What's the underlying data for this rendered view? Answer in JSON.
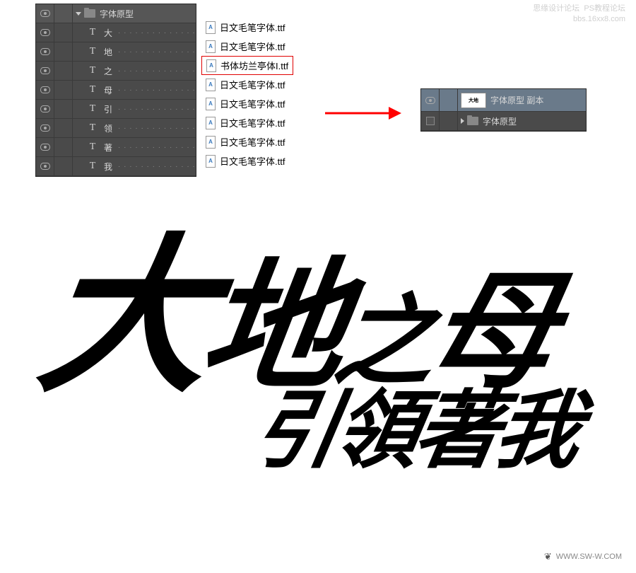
{
  "left_panel": {
    "group_name": "字体原型",
    "layers": [
      {
        "name": "大"
      },
      {
        "name": "地"
      },
      {
        "name": "之"
      },
      {
        "name": "母"
      },
      {
        "name": "引"
      },
      {
        "name": "领"
      },
      {
        "name": "著"
      },
      {
        "name": "我"
      }
    ]
  },
  "font_files": [
    {
      "name": "日文毛笔字体.ttf",
      "highlighted": false
    },
    {
      "name": "日文毛笔字体.ttf",
      "highlighted": false
    },
    {
      "name": "书体坊兰亭体I.ttf",
      "highlighted": true
    },
    {
      "name": "日文毛笔字体.ttf",
      "highlighted": false
    },
    {
      "name": "日文毛笔字体.ttf",
      "highlighted": false
    },
    {
      "name": "日文毛笔字体.ttf",
      "highlighted": false
    },
    {
      "name": "日文毛笔字体.ttf",
      "highlighted": false
    },
    {
      "name": "日文毛笔字体.ttf",
      "highlighted": false
    }
  ],
  "right_panel": {
    "layers": [
      {
        "name": "字体原型 副本",
        "type": "smart",
        "selected": true
      },
      {
        "name": "字体原型",
        "type": "folder",
        "selected": false
      }
    ]
  },
  "calligraphy": {
    "line1": "大地之母",
    "line2": "引領著我"
  },
  "watermark_top": {
    "l1": "思缘设计论坛",
    "l2": "PS教程论坛",
    "l3": "bbs.16xx8.com"
  },
  "watermark_bottom": "WWW.SW-W.COM",
  "icons": {
    "file_badge": "A"
  }
}
